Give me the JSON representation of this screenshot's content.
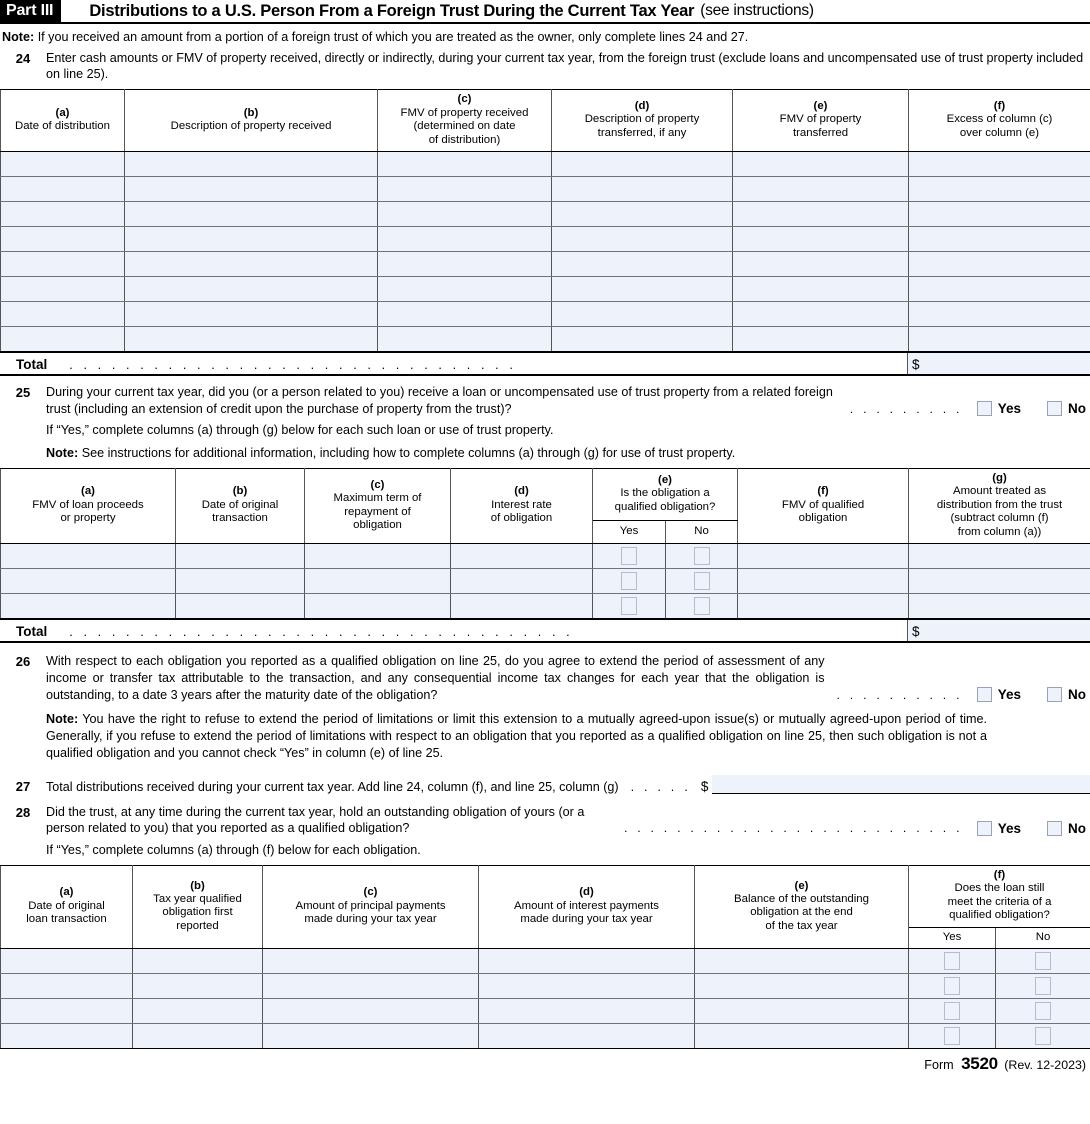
{
  "part": {
    "tag": "Part III",
    "title": "Distributions to a U.S. Person From a Foreign Trust During the Current Tax Year",
    "title_suffix": "(see instructions)"
  },
  "intro_note": {
    "label": "Note:",
    "text": "If you received an amount from a portion of a foreign trust of which you are treated as the owner, only complete lines 24 and 27."
  },
  "line24": {
    "number": "24",
    "text": "Enter cash amounts or FMV of property received, directly or indirectly, during your current tax year, from the foreign trust (exclude loans and uncompensated use of trust property included on line 25).",
    "columns": [
      {
        "letter": "(a)",
        "lines": [
          "Date of distribution"
        ]
      },
      {
        "letter": "(b)",
        "lines": [
          "Description of property received"
        ]
      },
      {
        "letter": "(c)",
        "lines": [
          "FMV of property received",
          "(determined on date",
          "of distribution)"
        ]
      },
      {
        "letter": "(d)",
        "lines": [
          "Description of property",
          "transferred, if any"
        ]
      },
      {
        "letter": "(e)",
        "lines": [
          "FMV of property",
          "transferred"
        ]
      },
      {
        "letter": "(f)",
        "lines": [
          "Excess of column (c)",
          "over column (e)"
        ]
      }
    ],
    "row_count": 8,
    "total_label": "Total",
    "total_dots": ". . . . . . . . . . . . . . . . . . . . . . . . . . . . . . . .",
    "total_currency": "$",
    "total_value": ""
  },
  "line25": {
    "number": "25",
    "text": "During your current tax year, did you (or a person related to you) receive a loan or uncompensated use of trust property from a related foreign trust (including an extension of credit upon the purchase of property from the trust)?",
    "dots": ". . . . . . . . .",
    "yes_label": "Yes",
    "no_label": "No",
    "if_yes": "If “Yes,” complete columns (a) through (g) below for each such loan or use of trust property.",
    "note_label": "Note:",
    "note_text": "See instructions for additional information, including how to complete columns (a) through (g) for use of trust property.",
    "columns": [
      {
        "letter": "(a)",
        "lines": [
          "FMV of loan proceeds",
          "or property"
        ]
      },
      {
        "letter": "(b)",
        "lines": [
          "Date of original",
          "transaction"
        ]
      },
      {
        "letter": "(c)",
        "lines": [
          "Maximum term of",
          "repayment of",
          "obligation"
        ]
      },
      {
        "letter": "(d)",
        "lines": [
          "Interest rate",
          "of obligation"
        ]
      },
      {
        "letter": "(e)",
        "lines": [
          "Is the obligation a",
          "qualified obligation?"
        ],
        "sub": [
          "Yes",
          "No"
        ]
      },
      {
        "letter": "(f)",
        "lines": [
          "FMV of qualified",
          "obligation"
        ]
      },
      {
        "letter": "(g)",
        "lines": [
          "Amount treated as",
          "distribution from the trust",
          "(subtract column (f)",
          "from column (a))"
        ]
      }
    ],
    "row_count": 3,
    "total_label": "Total",
    "total_dots": ". . . . . . . . . . . . . . . . . . . . . . . . . . . . . . . . . . . .",
    "total_currency": "$",
    "total_value": ""
  },
  "line26": {
    "number": "26",
    "text": "With respect to each obligation you reported as a qualified obligation on line 25, do you agree to extend the period of assessment of any income or transfer tax attributable to the transaction, and any consequential income tax changes for each year that the obligation is outstanding, to a date 3 years after the maturity date of the obligation?",
    "dots": ". . . . . . . . . .",
    "yes_label": "Yes",
    "no_label": "No",
    "note_label": "Note:",
    "note_text": "You have the right to refuse to extend the period of limitations or limit this extension to a mutually agreed-upon issue(s) or mutually agreed-upon period of time. Generally, if you refuse to extend the period of limitations with respect to an obligation that you reported as a qualified obligation on line 25, then such obligation is not a qualified obligation and you cannot check “Yes” in column (e) of line 25."
  },
  "line27": {
    "number": "27",
    "text": "Total distributions received during your current tax year. Add line 24, column (f), and line 25, column (g)",
    "dots": ". . . . .",
    "currency": "$",
    "value": ""
  },
  "line28": {
    "number": "28",
    "text": "Did the trust, at any time during the current tax year, hold an outstanding obligation of yours (or a person related to you) that you reported as a qualified obligation?",
    "dots": ". . . . . . . . . . . . . . . . . . . . . . . . . .",
    "yes_label": "Yes",
    "no_label": "No",
    "if_yes": "If “Yes,” complete columns (a) through (f) below for each obligation.",
    "columns": [
      {
        "letter": "(a)",
        "lines": [
          "Date of original",
          "loan transaction"
        ]
      },
      {
        "letter": "(b)",
        "lines": [
          "Tax year qualified",
          "obligation first",
          "reported"
        ]
      },
      {
        "letter": "(c)",
        "lines": [
          "Amount of principal payments",
          "made during your tax year"
        ]
      },
      {
        "letter": "(d)",
        "lines": [
          "Amount of interest payments",
          "made during your tax year"
        ]
      },
      {
        "letter": "(e)",
        "lines": [
          "Balance of the outstanding",
          "obligation at the end",
          "of the tax year"
        ]
      },
      {
        "letter": "(f)",
        "lines": [
          "Does the loan still",
          "meet the criteria of a",
          "qualified obligation?"
        ],
        "sub": [
          "Yes",
          "No"
        ]
      }
    ],
    "row_count": 4
  },
  "footer": {
    "form_label": "Form",
    "form_number": "3520",
    "revision": "(Rev. 12-2023)"
  },
  "colors": {
    "field_fill": "#eef2fb",
    "rule": "#000000",
    "checkbox_border": "#9aa3b5"
  }
}
